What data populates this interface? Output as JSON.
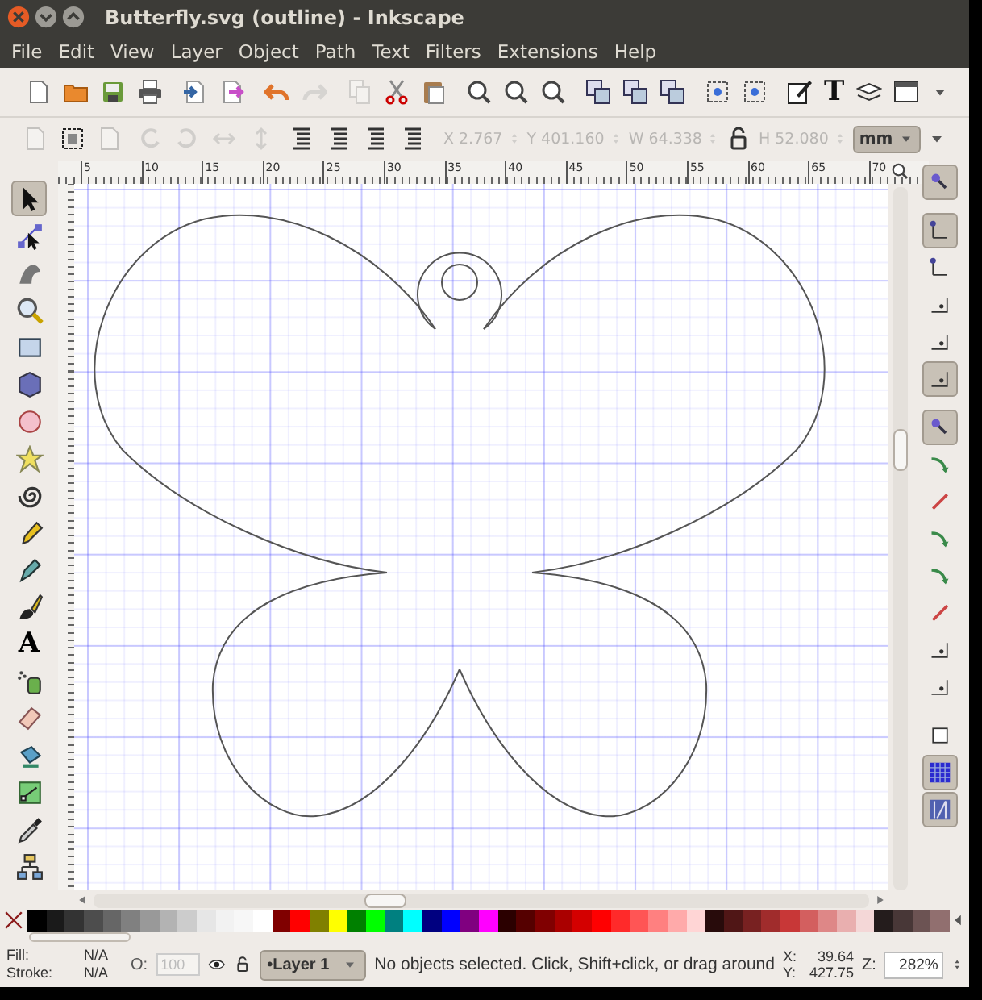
{
  "window": {
    "title": "Butterfly.svg (outline) - Inkscape"
  },
  "menu": [
    "File",
    "Edit",
    "View",
    "Layer",
    "Object",
    "Path",
    "Text",
    "Filters",
    "Extensions",
    "Help"
  ],
  "commands": [
    [
      {
        "kind": "doc",
        "disabled": false
      },
      {
        "kind": "folder",
        "disabled": false
      },
      {
        "kind": "disk",
        "disabled": false
      },
      {
        "kind": "printer",
        "disabled": false
      }
    ],
    [
      {
        "kind": "import",
        "disabled": false
      },
      {
        "kind": "export",
        "disabled": false
      }
    ],
    [
      {
        "kind": "undo",
        "disabled": false
      },
      {
        "kind": "redo",
        "disabled": true
      }
    ],
    [
      {
        "kind": "copy",
        "disabled": true
      },
      {
        "kind": "cut",
        "disabled": false
      },
      {
        "kind": "paste",
        "disabled": false
      }
    ],
    [
      {
        "kind": "zoom",
        "disabled": false
      },
      {
        "kind": "zoom",
        "disabled": false
      },
      {
        "kind": "zoom",
        "disabled": false
      }
    ],
    [
      {
        "kind": "stack",
        "disabled": false
      },
      {
        "kind": "stack",
        "disabled": false
      },
      {
        "kind": "stack",
        "disabled": false
      }
    ],
    [
      {
        "kind": "nodes",
        "disabled": false
      },
      {
        "kind": "nodes",
        "disabled": false
      }
    ],
    [
      {
        "kind": "pen",
        "disabled": false
      },
      {
        "kind": "glyph",
        "text": "T",
        "disabled": false
      },
      {
        "kind": "layers",
        "disabled": false
      },
      {
        "kind": "window",
        "disabled": false
      },
      {
        "kind": "caret",
        "disabled": false
      }
    ]
  ],
  "transform_icons": [
    [
      {
        "kind": "doc",
        "disabled": true
      },
      {
        "kind": "frame",
        "disabled": false
      },
      {
        "kind": "doc",
        "disabled": true
      }
    ],
    [
      {
        "kind": "rotccw",
        "disabled": true
      },
      {
        "kind": "rotcw",
        "disabled": true
      },
      {
        "kind": "fliph",
        "disabled": true
      },
      {
        "kind": "flipv",
        "disabled": true
      }
    ],
    [
      {
        "kind": "order",
        "disabled": false
      },
      {
        "kind": "order",
        "disabled": false
      },
      {
        "kind": "order",
        "disabled": false
      },
      {
        "kind": "order",
        "disabled": false
      }
    ]
  ],
  "geometry": [
    {
      "kind": "field",
      "label": "X",
      "value": "2.767",
      "disabled": true
    },
    {
      "kind": "field",
      "label": "Y",
      "value": "401.160",
      "disabled": true
    },
    {
      "kind": "field",
      "label": "W",
      "value": "64.338",
      "disabled": true
    },
    {
      "kind": "lock",
      "disabled": false
    },
    {
      "kind": "field",
      "label": "H",
      "value": "52.080",
      "disabled": true
    }
  ],
  "unit": "mm",
  "ruler_labels": [
    "5",
    "10",
    "15",
    "20",
    "25",
    "30",
    "35",
    "40",
    "45",
    "50",
    "55",
    "60",
    "65",
    "70"
  ],
  "tools": [
    {
      "kind": "arrow",
      "selected": true
    },
    {
      "kind": "node",
      "selected": false
    },
    {
      "kind": "tweak",
      "selected": false
    },
    {
      "kind": "zoomtool",
      "selected": false
    },
    {
      "kind": "rect",
      "selected": false
    },
    {
      "kind": "box",
      "selected": false
    },
    {
      "kind": "ellipse",
      "selected": false
    },
    {
      "kind": "star",
      "selected": false
    },
    {
      "kind": "spiral",
      "selected": false
    },
    {
      "kind": "pencil",
      "selected": false
    },
    {
      "kind": "bezier",
      "selected": false
    },
    {
      "kind": "brush",
      "selected": false
    },
    {
      "kind": "glyph",
      "text": "A",
      "selected": false
    },
    {
      "kind": "spray",
      "selected": false
    },
    {
      "kind": "eraser",
      "selected": false
    },
    {
      "kind": "bucket",
      "selected": false
    },
    {
      "kind": "gradient",
      "selected": false
    },
    {
      "kind": "dropper",
      "selected": false
    },
    {
      "kind": "connector",
      "selected": false
    }
  ],
  "snap": [
    [
      {
        "kind": "magnet",
        "on": true
      }
    ],
    [
      {
        "kind": "corner",
        "on": true
      },
      {
        "kind": "corner",
        "on": false
      },
      {
        "kind": "cornerdot",
        "on": false
      },
      {
        "kind": "cornerdot",
        "on": false
      },
      {
        "kind": "cornerdot",
        "on": true
      }
    ],
    [
      {
        "kind": "magnet",
        "on": true
      },
      {
        "kind": "curve",
        "on": false
      },
      {
        "kind": "line",
        "on": false
      },
      {
        "kind": "curve",
        "on": false
      },
      {
        "kind": "curve",
        "on": false
      },
      {
        "kind": "line",
        "on": false
      },
      {
        "kind": "cornerdot",
        "on": false
      },
      {
        "kind": "cornerdot",
        "on": false
      }
    ],
    [
      {
        "kind": "square",
        "on": false
      },
      {
        "kind": "grid",
        "on": true
      },
      {
        "kind": "guides",
        "on": true
      }
    ]
  ],
  "palette": [
    {
      "color": "#000000"
    },
    {
      "color": "#1a1a1a"
    },
    {
      "color": "#333333"
    },
    {
      "color": "#4d4d4d"
    },
    {
      "color": "#666666"
    },
    {
      "color": "#808080"
    },
    {
      "color": "#999999"
    },
    {
      "color": "#b3b3b3"
    },
    {
      "color": "#cccccc"
    },
    {
      "color": "#e6e6e6"
    },
    {
      "color": "#f2f2f2"
    },
    {
      "color": "#f7f7f7"
    },
    {
      "color": "#ffffff"
    },
    {
      "color": "#800000"
    },
    {
      "color": "#ff0000"
    },
    {
      "color": "#808000"
    },
    {
      "color": "#ffff00"
    },
    {
      "color": "#008000"
    },
    {
      "color": "#00ff00"
    },
    {
      "color": "#008080"
    },
    {
      "color": "#00ffff"
    },
    {
      "color": "#000080"
    },
    {
      "color": "#0000ff"
    },
    {
      "color": "#800080"
    },
    {
      "color": "#ff00ff"
    },
    {
      "color": "#2b0000"
    },
    {
      "color": "#550000"
    },
    {
      "color": "#800001"
    },
    {
      "color": "#aa0000"
    },
    {
      "color": "#d40000"
    },
    {
      "color": "#ff0001"
    },
    {
      "color": "#ff2a2a"
    },
    {
      "color": "#ff5555"
    },
    {
      "color": "#ff8080"
    },
    {
      "color": "#ffaaaa"
    },
    {
      "color": "#ffd5d5"
    },
    {
      "color": "#280b0b"
    },
    {
      "color": "#501616"
    },
    {
      "color": "#782121"
    },
    {
      "color": "#a02c2c"
    },
    {
      "color": "#c83737"
    },
    {
      "color": "#d35f5f"
    },
    {
      "color": "#de8787"
    },
    {
      "color": "#e9afaf"
    },
    {
      "color": "#f4d7d7"
    },
    {
      "color": "#241c1c"
    },
    {
      "color": "#483737"
    },
    {
      "color": "#6c5353"
    },
    {
      "color": "#916f6f"
    }
  ],
  "status": {
    "fill_label": "Fill:",
    "fill_value": "N/A",
    "stroke_label": "Stroke:",
    "stroke_value": "N/A",
    "opacity_label": "O:",
    "opacity_value": "100",
    "layer": "•Layer 1",
    "message": "No objects selected. Click, Shift+click, or drag around",
    "x_label": "X:",
    "x_value": "39.64",
    "y_label": "Y:",
    "y_value": "427.75",
    "zoom_label": "Z:",
    "zoom_value": "282%"
  }
}
